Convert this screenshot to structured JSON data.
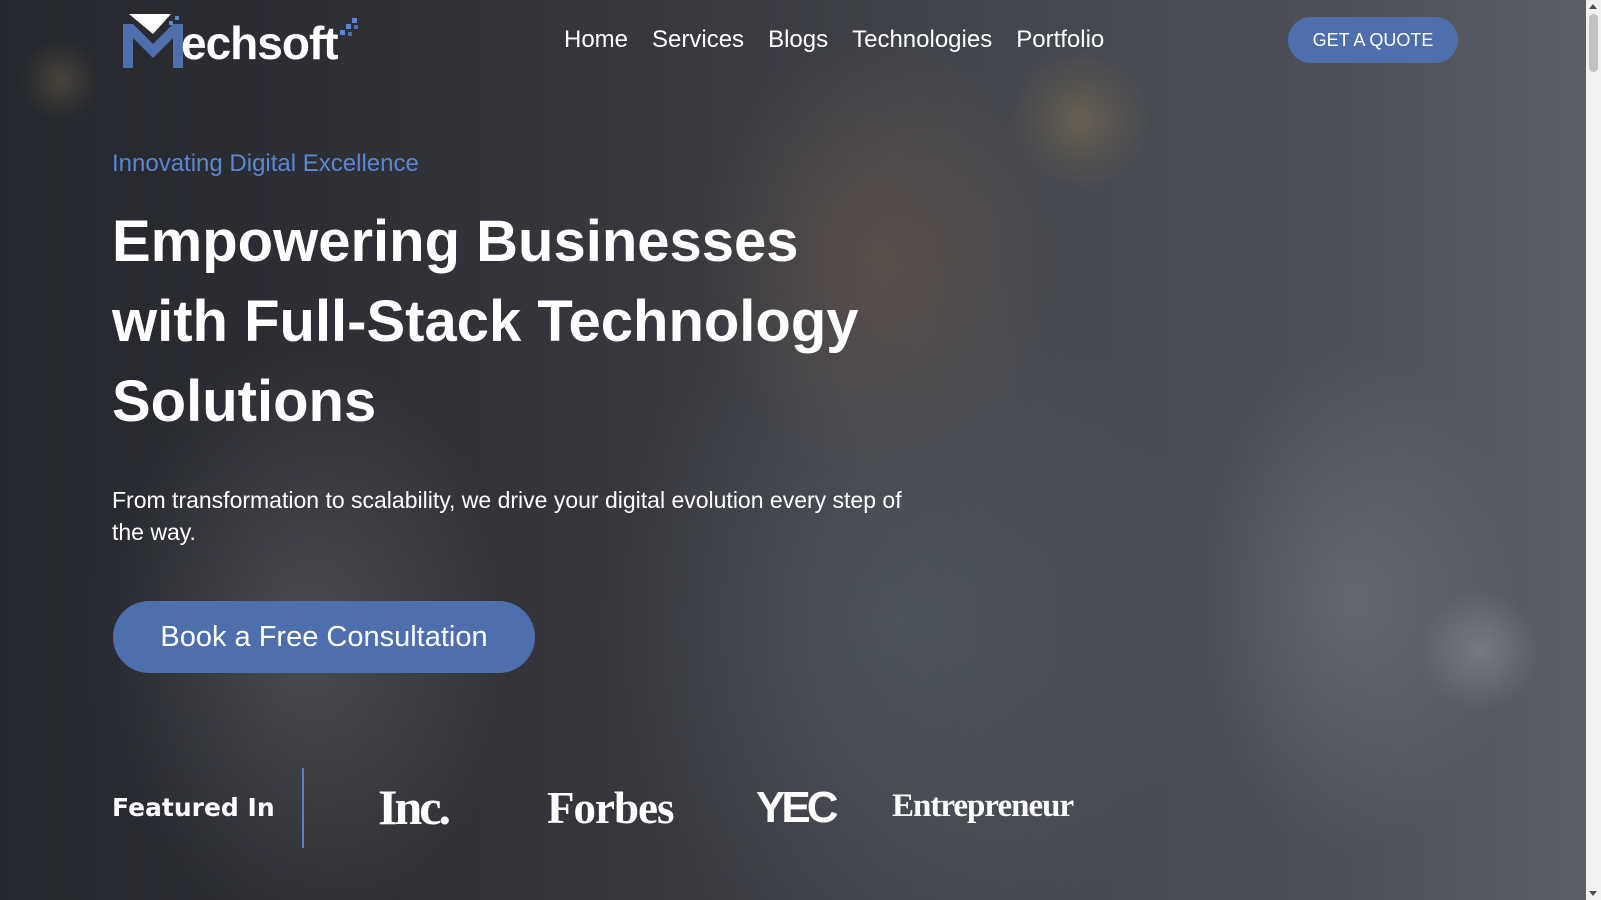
{
  "header": {
    "logo_text": "echsoft",
    "logo_alt": "Mechsoft",
    "nav": [
      {
        "label": "Home"
      },
      {
        "label": "Services"
      },
      {
        "label": "Blogs"
      },
      {
        "label": "Technologies"
      },
      {
        "label": "Portfolio"
      }
    ],
    "quote_button": "GET A QUOTE"
  },
  "hero": {
    "tagline": "Innovating Digital Excellence",
    "headline_lines": [
      "Empowering Businesses",
      "with Full-Stack Technology",
      "Solutions"
    ],
    "subtitle": "From transformation to scalability, we drive your digital evolution every step of the way.",
    "cta_label": "Book a Free Consultation"
  },
  "featured": {
    "label": "Featured In",
    "brands": [
      "Inc.",
      "Forbes",
      "YEC",
      "Entrepreneur"
    ]
  },
  "colors": {
    "accent": "#4d6fae",
    "tagline": "#5b86d1",
    "divider": "#5b7fc2"
  }
}
